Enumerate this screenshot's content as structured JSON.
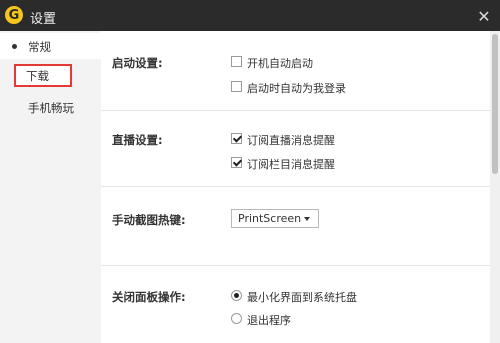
{
  "window": {
    "title": "设置",
    "logo_letter": "G",
    "close_glyph": "✕"
  },
  "sidebar": {
    "items": [
      {
        "label": "常规",
        "active": true
      },
      {
        "label": "下载",
        "highlighted": true
      },
      {
        "label": "手机畅玩"
      }
    ]
  },
  "sections": {
    "startup": {
      "label": "启动设置:",
      "options": [
        {
          "label": "开机自动启动",
          "checked": false
        },
        {
          "label": "启动时自动为我登录",
          "checked": false
        }
      ]
    },
    "live": {
      "label": "直播设置:",
      "options": [
        {
          "label": "订阅直播消息提醒",
          "checked": true
        },
        {
          "label": "订阅栏目消息提醒",
          "checked": true
        }
      ]
    },
    "hotkey": {
      "label": "手动截图热键:",
      "value": "PrintScreen"
    },
    "close_panel": {
      "label": "关闭面板操作:",
      "options": [
        {
          "label": "最小化界面到系统托盘",
          "selected": true
        },
        {
          "label": "退出程序",
          "selected": false
        }
      ]
    }
  },
  "colors": {
    "titlebar": "#2b2b2b",
    "logo": "#f6c51b",
    "highlight_outline": "#e53935",
    "sidebar_bg": "#f3f3f3"
  }
}
